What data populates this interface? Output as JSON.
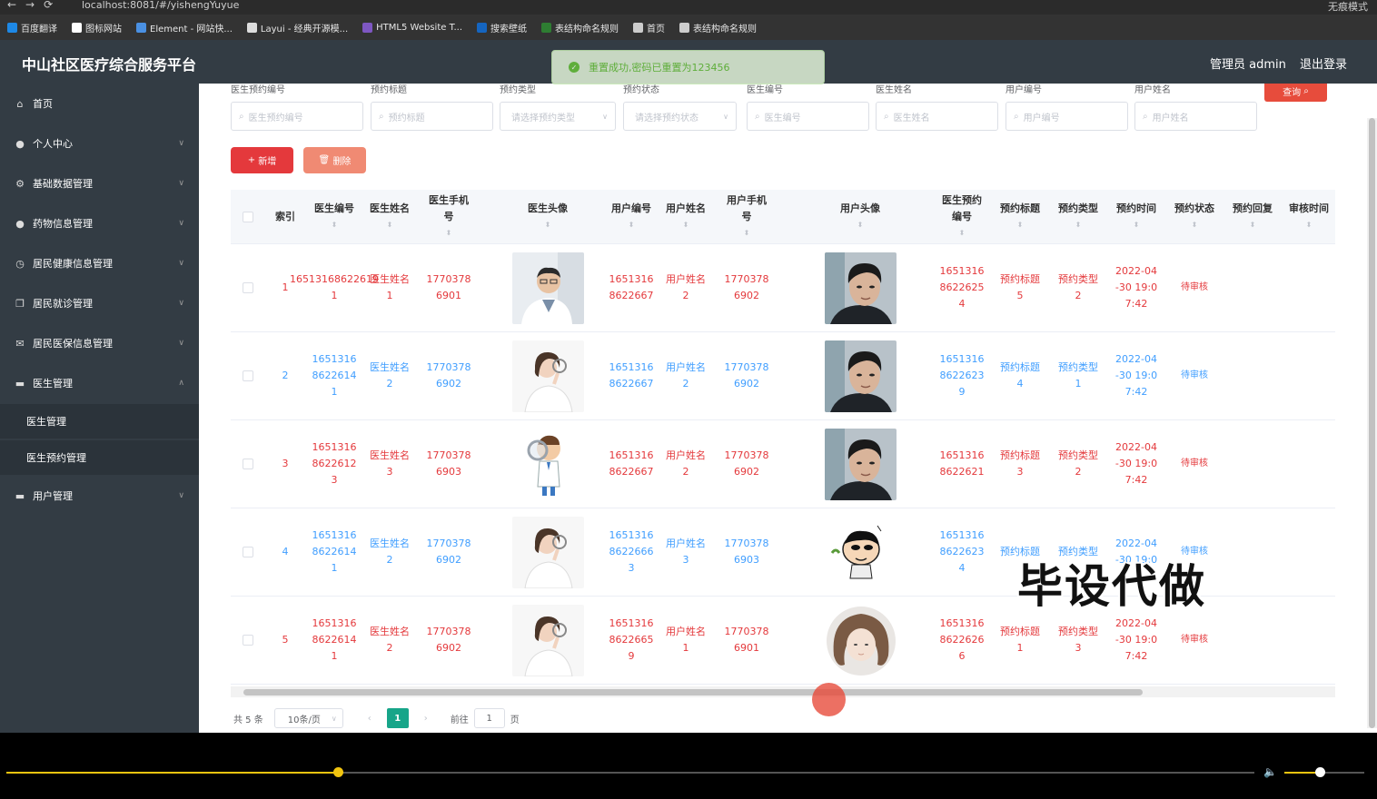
{
  "browser": {
    "url": "localhost:8081/#/yishengYuyue",
    "mode": "无痕模式",
    "bookmarks": [
      "百度翻译",
      "图标网站",
      "Element - 网站快...",
      "Layui - 经典开源模...",
      "HTML5 Website T...",
      "搜索壁纸",
      "表结构命名规则",
      "首页",
      "表结构命名规则"
    ]
  },
  "header": {
    "brand": "中山社区医疗综合服务平台",
    "user": "管理员 admin",
    "logout": "退出登录"
  },
  "toast": "重置成功,密码已重置为123456",
  "sidebar": {
    "items": [
      {
        "label": "首页",
        "icon": "home-icon"
      },
      {
        "label": "个人中心",
        "icon": "user-icon"
      },
      {
        "label": "基础数据管理",
        "icon": "settings-icon"
      },
      {
        "label": "药物信息管理",
        "icon": "bulb-icon"
      },
      {
        "label": "居民健康信息管理",
        "icon": "clock-icon"
      },
      {
        "label": "居民就诊管理",
        "icon": "copy-icon"
      },
      {
        "label": "居民医保信息管理",
        "icon": "mail-icon"
      },
      {
        "label": "医生管理",
        "icon": "bank-icon"
      },
      {
        "label": "用户管理",
        "icon": "bank-icon"
      }
    ],
    "sub": [
      "医生管理",
      "医生预约管理"
    ]
  },
  "filters": [
    {
      "label": "医生预约编号",
      "placeholder": "医生预约编号"
    },
    {
      "label": "预约标题",
      "placeholder": "预约标题"
    },
    {
      "label": "预约类型",
      "placeholder": "请选择预约类型"
    },
    {
      "label": "预约状态",
      "placeholder": "请选择预约状态"
    },
    {
      "label": "医生编号",
      "placeholder": "医生编号"
    },
    {
      "label": "医生姓名",
      "placeholder": "医生姓名"
    },
    {
      "label": "用户编号",
      "placeholder": "用户编号"
    },
    {
      "label": "用户姓名",
      "placeholder": "用户姓名"
    }
  ],
  "buttons": {
    "search": "查询",
    "add": "新增",
    "delete": "删除"
  },
  "table": {
    "headers": [
      "索引",
      "医生编号",
      "医生姓名",
      "医生手机号",
      "医生头像",
      "用户编号",
      "用户姓名",
      "用户手机号",
      "用户头像",
      "医生预约编号",
      "预约标题",
      "预约类型",
      "预约时间",
      "预约状态",
      "预约回复",
      "审核时间"
    ],
    "rows": [
      {
        "idx": "1",
        "doc_no": "16513168622619\n1",
        "doc_name": "医生姓名\n1",
        "doc_phone": "1770378\n6901",
        "user_no": "1651316\n8622667",
        "user_name": "用户姓名\n2",
        "user_phone": "1770378\n6902",
        "appt_no": "1651316\n8622625\n4",
        "title": "预约标题\n5",
        "type": "预约类型\n2",
        "time": "2022-04\n-30 19:0\n7:42",
        "status": "待审核",
        "color": "red",
        "doc_av": "male",
        "user_av": "man"
      },
      {
        "idx": "2",
        "doc_no": "1651316\n8622614\n1",
        "doc_name": "医生姓名\n2",
        "doc_phone": "1770378\n6902",
        "user_no": "1651316\n8622667",
        "user_name": "用户姓名\n2",
        "user_phone": "1770378\n6902",
        "appt_no": "1651316\n8622623\n9",
        "title": "预约标题\n4",
        "type": "预约类型\n1",
        "time": "2022-04\n-30 19:0\n7:42",
        "status": "待审核",
        "color": "blue",
        "doc_av": "female",
        "user_av": "man"
      },
      {
        "idx": "3",
        "doc_no": "1651316\n8622612\n3",
        "doc_name": "医生姓名\n3",
        "doc_phone": "1770378\n6903",
        "user_no": "1651316\n8622667",
        "user_name": "用户姓名\n2",
        "user_phone": "1770378\n6902",
        "appt_no": "1651316\n8622621",
        "title": "预约标题\n3",
        "type": "预约类型\n2",
        "time": "2022-04\n-30 19:0\n7:42",
        "status": "待审核",
        "color": "red",
        "doc_av": "cartoon",
        "user_av": "man"
      },
      {
        "idx": "4",
        "doc_no": "1651316\n8622614\n1",
        "doc_name": "医生姓名\n2",
        "doc_phone": "1770378\n6902",
        "user_no": "1651316\n8622666\n3",
        "user_name": "用户姓名\n3",
        "user_phone": "1770378\n6903",
        "appt_no": "1651316\n8622623\n4",
        "title": "预约标题",
        "type": "预约类型",
        "time": "2022-04\n-30 19:0",
        "status": "待审核",
        "color": "blue",
        "doc_av": "female",
        "user_av": "crayon"
      },
      {
        "idx": "5",
        "doc_no": "1651316\n8622614\n1",
        "doc_name": "医生姓名\n2",
        "doc_phone": "1770378\n6902",
        "user_no": "1651316\n8622665\n9",
        "user_name": "用户姓名\n1",
        "user_phone": "1770378\n6901",
        "appt_no": "1651316\n8622626\n6",
        "title": "预约标题\n1",
        "type": "预约类型\n3",
        "time": "2022-04\n-30 19:0\n7:42",
        "status": "待审核",
        "color": "red",
        "doc_av": "female",
        "user_av": "girl"
      }
    ]
  },
  "pager": {
    "total": "共 5 条",
    "size": "10条/页",
    "current": "1",
    "goto": "前往",
    "goto_value": "1",
    "page_unit": "页"
  },
  "watermark": "毕设代做"
}
